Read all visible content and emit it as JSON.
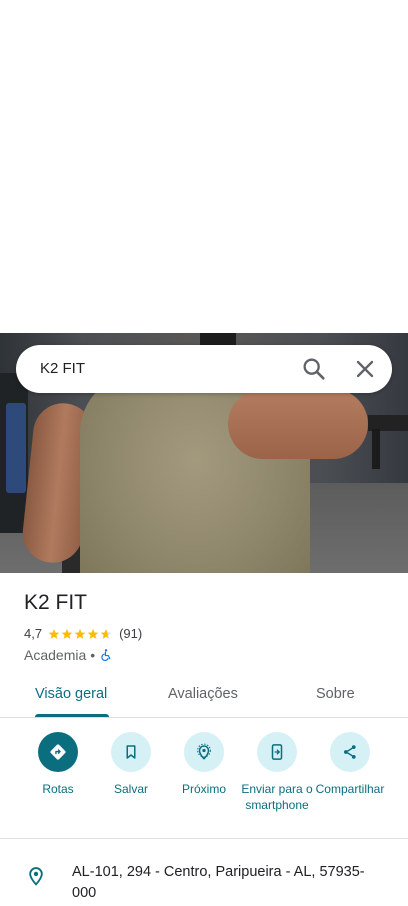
{
  "search": {
    "query": "K2 FIT"
  },
  "place": {
    "name": "K2 FIT",
    "rating": "4,7",
    "reviews_count": "(91)",
    "stars_value": 4.7,
    "category": "Academia",
    "separator": "•"
  },
  "tabs": [
    {
      "label": "Visão geral",
      "active": true
    },
    {
      "label": "Avaliações",
      "active": false
    },
    {
      "label": "Sobre",
      "active": false
    }
  ],
  "actions": [
    {
      "label": "Rotas",
      "icon": "directions-icon"
    },
    {
      "label": "Salvar",
      "icon": "bookmark-icon"
    },
    {
      "label": "Próximo",
      "icon": "nearby-icon"
    },
    {
      "label": "Enviar para o smartphone",
      "icon": "send-to-phone-icon"
    },
    {
      "label": "Compartilhar",
      "icon": "share-icon"
    }
  ],
  "address": {
    "text": "AL-101, 294 - Centro, Paripueira - AL, 57935-000"
  },
  "colors": {
    "accent": "#0b6e7f",
    "action_bg": "#d6f1f6",
    "star": "#fbbc04"
  }
}
